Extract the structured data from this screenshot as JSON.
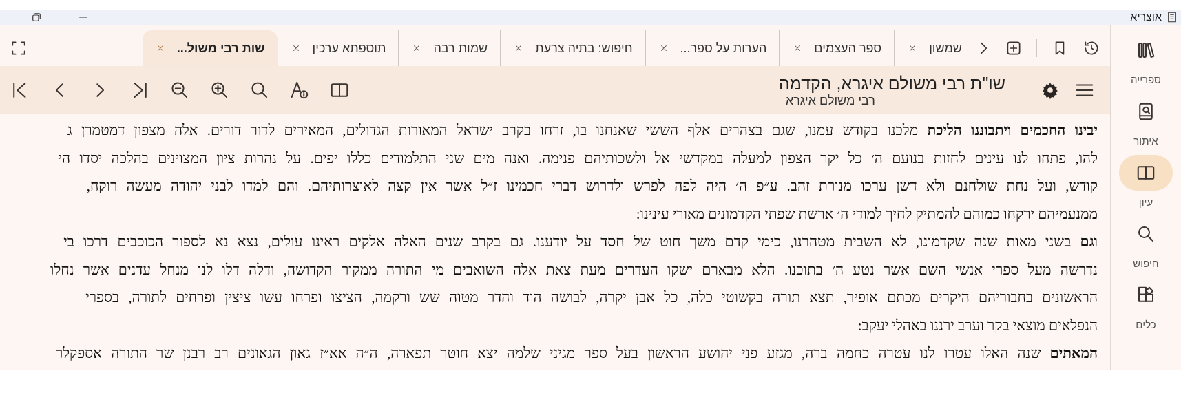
{
  "window": {
    "title": "אוצריא"
  },
  "tabs": [
    {
      "label": "שמשון",
      "selected": false
    },
    {
      "label": "ספר העצמים",
      "selected": false
    },
    {
      "label": "הערות על ספר...",
      "selected": false
    },
    {
      "label": "חיפוש: בתיה צרעת",
      "selected": false
    },
    {
      "label": "שמות רבה",
      "selected": false
    },
    {
      "label": "תוספתא ערכין",
      "selected": false
    },
    {
      "label": "שות רבי משול...",
      "selected": true
    }
  ],
  "document": {
    "title": "שו\"ת רבי משולם איגרא, הקדמה",
    "author": "רבי משולם איגרא"
  },
  "paragraphs": [
    {
      "lines": [
        "**יבינו החכמים ויתבוננו הליכת** מלכנו בקודש עמנו, שגם בצהרים אלף הששי שאנחנו בו, זרחו בקרב ישראל המאורות הגדולים, המאירים לדור דורים. אלה מצפון דמטמרן ג",
        "להו, פתחו לנו עינים לחזות בנועם ה׳ כל יקר הצפון למעלה במקדשי אל ולשכותיהם פנימה. ואנה מים שני התלמודים כללו יפים. על נהרות ציון המצוינים בהלכה יסדו הי",
        "קודש, ועל נחת שולחנם ולא דשן ערכו מנורת זהב. ע״פ ה׳ היה לפה לפרש ולדרוש דברי חכמינו ז״ל אשר אין קצה לאוצרותיהם. והם למדו לבני יהודה מעשה רוקח,",
        "ממנעמיהם ירקחו כמוהם להמתיק לחיך למודי ה׳ ארשת שפתי הקדמונים מאורי עינינו:"
      ]
    },
    {
      "lines": [
        "**וגם** בשני מאות שנה שקדמונו, לא השבית מטהרנו, כימי קדם משך חוט של חסד על יודענו. גם בקרב שנים האלה אלקים ראינו עולים, נצא נא לספור הכוכבים דרכו בי",
        "נדרשה מעל ספרי אנשי השם אשר נטע ה׳ בתוכנו. הלא מבארם ישקו העדרים מעת צאת אלה השואבים מי התורה ממקור הקדושה, ודלה דלו לנו מנחל עדנים אשר נחלו",
        "הראשונים בחבוריהם היקרים מכתם אופיר, תצא תורה בקשוטי כלה, כל אבן יקרה, לבושה הוד והדר מטוה שש ורקמה, הציצו ופרחו עשו ציצין ופרחים לתורה, בספרי",
        "הנפלאים מוצאי בקר וערב ירננו באהלי יעקב:"
      ]
    },
    {
      "lines": [
        "**המאתים** שנה האלו עטרו לנו עטרה כחמה ברה, מגזע פני יהושע הראשון בעל ספר מגיני שלמה יצא חוטר תפארה, ה״ה אא״ז גאון הגאונים רב רבנן שר התורה אספקלר"
      ]
    }
  ],
  "sidebar": {
    "items": [
      {
        "label": "ספרייה",
        "selected": false
      },
      {
        "label": "איתור",
        "selected": false
      },
      {
        "label": "עיון",
        "selected": true
      },
      {
        "label": "חיפוש",
        "selected": false
      },
      {
        "label": "כלים",
        "selected": false
      }
    ]
  }
}
